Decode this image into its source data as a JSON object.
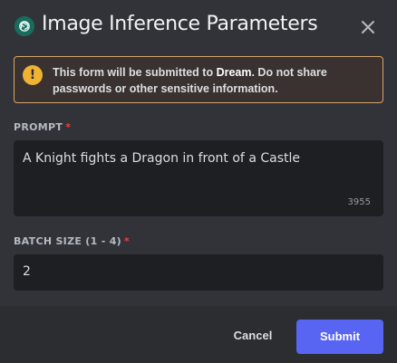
{
  "modal": {
    "title": "Image Inference Parameters",
    "app_icon": "openai-icon",
    "close_icon": "close-icon"
  },
  "warning": {
    "icon": "exclamation-icon",
    "text_before": "This form will be submitted to ",
    "target": "Dream",
    "text_after": ". Do not share passwords or other sensitive information."
  },
  "fields": {
    "prompt": {
      "label": "PROMPT",
      "required_mark": "*",
      "value": "A Knight fights a Dragon in front of a Castle",
      "counter": "3955"
    },
    "batch_size": {
      "label": "BATCH SIZE (1 - 4)",
      "required_mark": "*",
      "value": "2"
    }
  },
  "footer": {
    "cancel_label": "Cancel",
    "submit_label": "Submit"
  },
  "colors": {
    "accent": "#5865f2",
    "warning_border": "#d9a56a",
    "warning_icon": "#f0b232",
    "required": "#f23f42"
  }
}
